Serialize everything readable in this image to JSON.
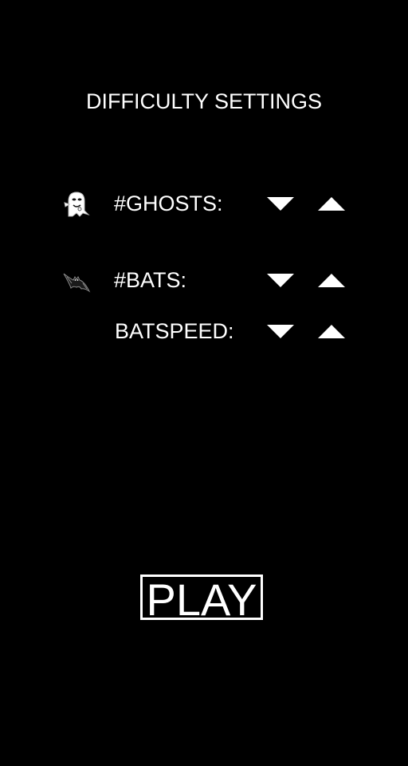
{
  "screen": {
    "title": "DIFFICULTY SETTINGS",
    "background_color": "#000000",
    "text_color": "#ffffff"
  },
  "settings": [
    {
      "id": "ghosts",
      "label": "#GHOSTS:",
      "sprite": "ghost-icon",
      "decrease_icon": "triangle-down-icon",
      "increase_icon": "triangle-up-icon"
    },
    {
      "id": "bats",
      "label": "#BATS:",
      "sprite": "bat-icon",
      "decrease_icon": "triangle-down-icon",
      "increase_icon": "triangle-up-icon"
    },
    {
      "id": "batspeed",
      "label": "BATSPEED:",
      "decrease_icon": "triangle-down-icon",
      "increase_icon": "triangle-up-icon"
    }
  ],
  "play_button": {
    "label": "PLAY"
  }
}
